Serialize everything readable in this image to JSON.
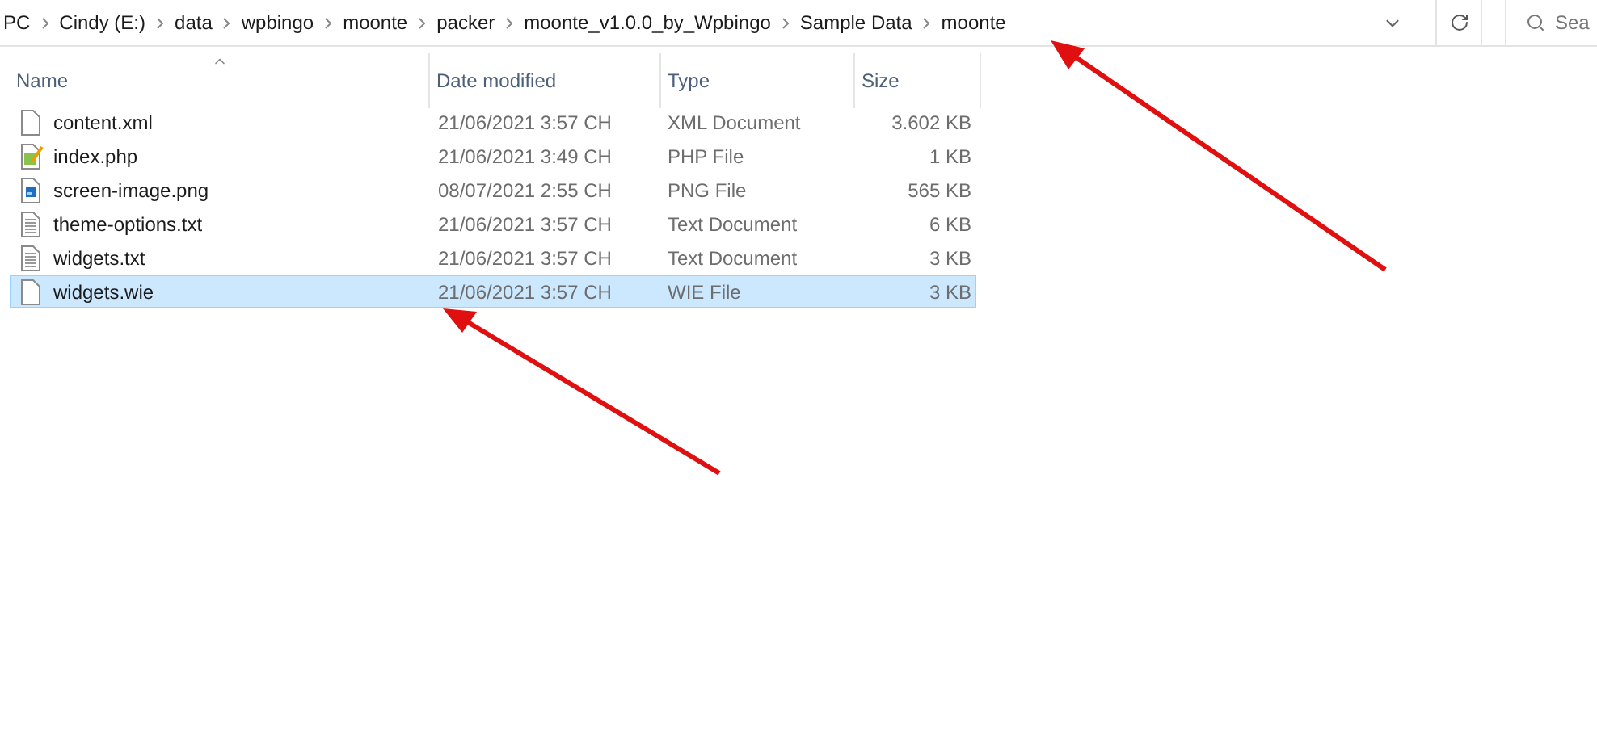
{
  "address_bar": {
    "crumbs": [
      "PC",
      "Cindy (E:)",
      "data",
      "wpbingo",
      "moonte",
      "packer",
      "moonte_v1.0.0_by_Wpbingo",
      "Sample Data",
      "moonte"
    ]
  },
  "search": {
    "placeholder": "Sea"
  },
  "table": {
    "columns": [
      {
        "label": "Name",
        "sorted": true
      },
      {
        "label": "Date modified",
        "sorted": false
      },
      {
        "label": "Type",
        "sorted": false
      },
      {
        "label": "Size",
        "sorted": false
      }
    ],
    "rows": [
      {
        "name": "content.xml",
        "kind": "blank",
        "date": "21/06/2021 3:57 CH",
        "type": "XML Document",
        "size": "3.602 KB",
        "selected": false
      },
      {
        "name": "index.php",
        "kind": "php",
        "date": "21/06/2021 3:49 CH",
        "type": "PHP File",
        "size": "1 KB",
        "selected": false
      },
      {
        "name": "screen-image.png",
        "kind": "image",
        "date": "08/07/2021 2:55 CH",
        "type": "PNG File",
        "size": "565 KB",
        "selected": false
      },
      {
        "name": "theme-options.txt",
        "kind": "text",
        "date": "21/06/2021 3:57 CH",
        "type": "Text Document",
        "size": "6 KB",
        "selected": false
      },
      {
        "name": "widgets.txt",
        "kind": "text",
        "date": "21/06/2021 3:57 CH",
        "type": "Text Document",
        "size": "3 KB",
        "selected": false
      },
      {
        "name": "widgets.wie",
        "kind": "blank",
        "date": "21/06/2021 3:57 CH",
        "type": "WIE File",
        "size": "3 KB",
        "selected": true
      }
    ]
  }
}
